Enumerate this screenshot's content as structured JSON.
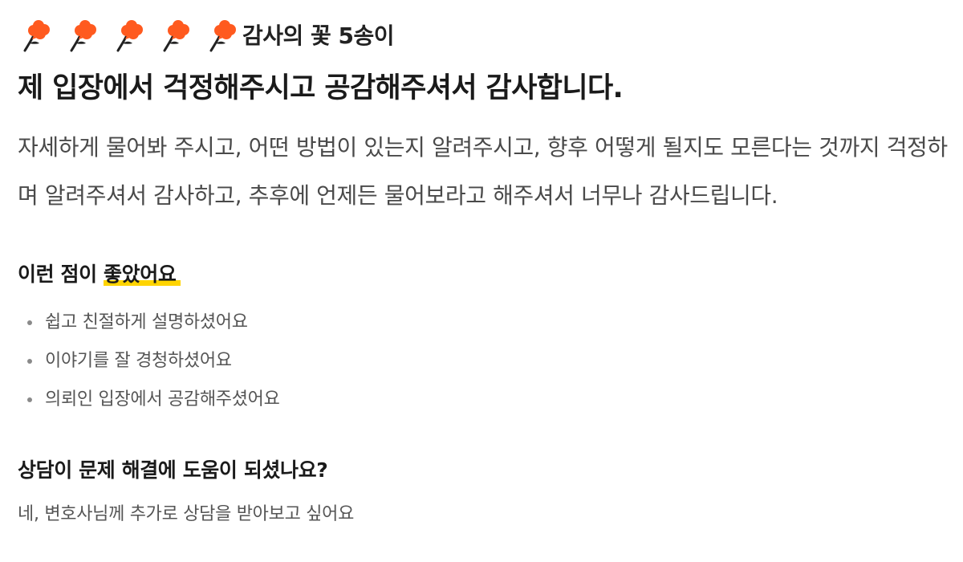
{
  "review": {
    "flower_icons": [
      "flower-icon",
      "flower-icon",
      "flower-icon",
      "flower-icon",
      "flower-icon"
    ],
    "flower_count": 5,
    "flower_caption": "감사의 꽃 5송이",
    "headline": "제 입장에서 걱정해주시고 공감해주셔서 감사합니다.",
    "body": "자세하게 물어봐 주시고, 어떤 방법이 있는지 알려주시고, 향후 어떻게 될지도 모른다는 것까지 걱정하며 알려주셔서 감사하고, 추후에 언제든 물어보라고 해주셔서 너무나 감사드립니다."
  },
  "good_points": {
    "title_prefix": "이런 점이 ",
    "title_highlight": "좋았어요",
    "items": [
      "쉽고 친절하게 설명하셨어요",
      "이야기를 잘 경청하셨어요",
      "의뢰인 입장에서 공감해주셨어요"
    ]
  },
  "help_question": {
    "title": "상담이 문제 해결에 도움이 되셨나요?",
    "answer": "네, 변호사님께 추가로 상담을 받아보고 싶어요"
  },
  "colors": {
    "flower": "#ff5a1f",
    "stem": "#222222",
    "highlight": "#ffd400"
  }
}
